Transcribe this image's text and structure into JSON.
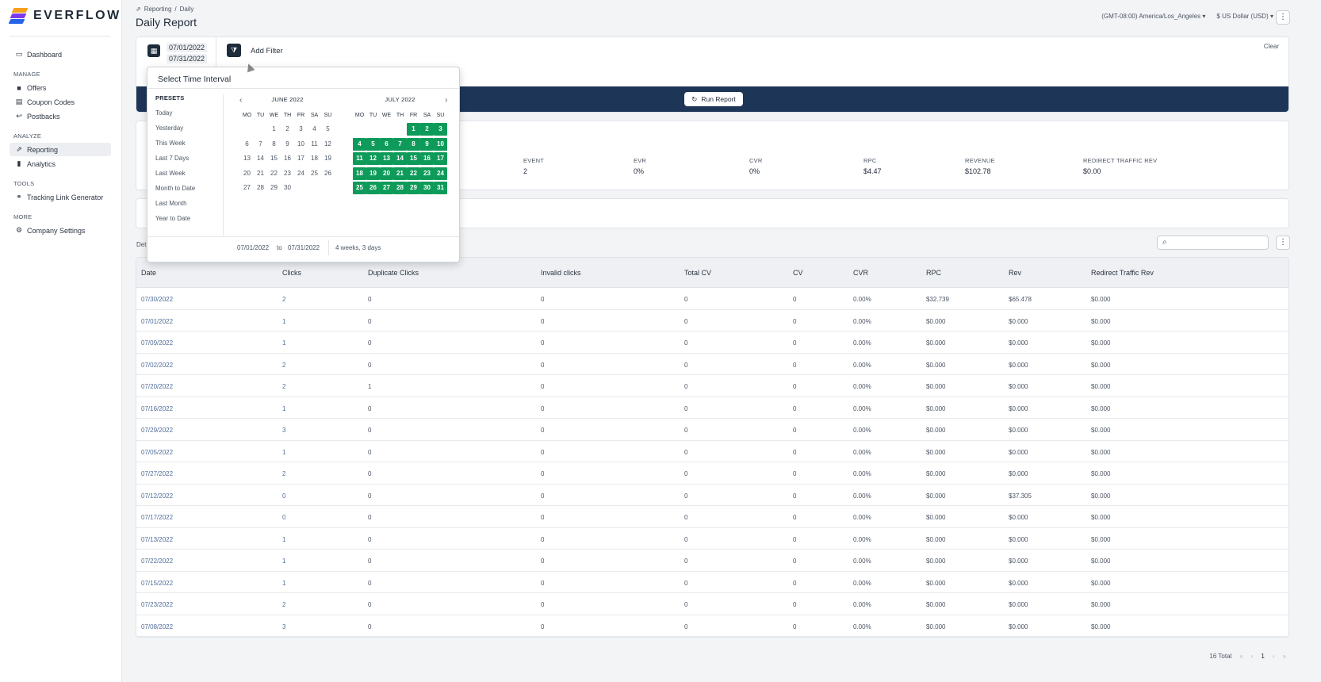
{
  "brand": {
    "name": "EVERFLOW"
  },
  "sidebar": {
    "top_items": [
      {
        "label": "Dashboard",
        "icon": "monitor-icon"
      }
    ],
    "sections": [
      {
        "title": "MANAGE",
        "items": [
          {
            "label": "Offers",
            "icon": "folder-icon"
          },
          {
            "label": "Coupon Codes",
            "icon": "list-icon"
          },
          {
            "label": "Postbacks",
            "icon": "back-arrow-icon"
          }
        ]
      },
      {
        "title": "ANALYZE",
        "items": [
          {
            "label": "Reporting",
            "icon": "chart-line-icon",
            "active": true
          },
          {
            "label": "Analytics",
            "icon": "bar-chart-icon"
          }
        ]
      },
      {
        "title": "TOOLS",
        "items": [
          {
            "label": "Tracking Link Generator",
            "icon": "link-icon"
          }
        ]
      },
      {
        "title": "MORE",
        "items": [
          {
            "label": "Company Settings",
            "icon": "gear-icon"
          }
        ]
      }
    ]
  },
  "header": {
    "breadcrumb": [
      "Reporting",
      "/",
      "Daily"
    ],
    "title": "Daily Report",
    "timezone": "(GMT-08:00) America/Los_Angeles",
    "currency": "$ US Dollar (USD)"
  },
  "filter": {
    "date_from": "07/01/2022",
    "date_to": "07/31/2022",
    "add_filter_label": "Add Filter",
    "clear_label": "Clear",
    "run_label": "Run Report"
  },
  "stats": [
    {
      "label": "EVENT",
      "value": "2"
    },
    {
      "label": "EVR",
      "value": "0%"
    },
    {
      "label": "CVR",
      "value": "0%"
    },
    {
      "label": "RPC",
      "value": "$4.47"
    },
    {
      "label": "REVENUE",
      "value": "$102.78"
    },
    {
      "label": "REDIRECT TRAFFIC REV",
      "value": "$0.00"
    }
  ],
  "details_label": "Det",
  "search": {
    "placeholder": ""
  },
  "table": {
    "columns": [
      "Date",
      "Clicks",
      "Duplicate Clicks",
      "Invalid clicks",
      "Total CV",
      "CV",
      "CVR",
      "RPC",
      "Rev",
      "Redirect Traffic Rev"
    ],
    "rows": [
      [
        "07/30/2022",
        "2",
        "0",
        "0",
        "0",
        "0",
        "0.00%",
        "$32.739",
        "$65.478",
        "$0.000"
      ],
      [
        "07/01/2022",
        "1",
        "0",
        "0",
        "0",
        "0",
        "0.00%",
        "$0.000",
        "$0.000",
        "$0.000"
      ],
      [
        "07/09/2022",
        "1",
        "0",
        "0",
        "0",
        "0",
        "0.00%",
        "$0.000",
        "$0.000",
        "$0.000"
      ],
      [
        "07/02/2022",
        "2",
        "0",
        "0",
        "0",
        "0",
        "0.00%",
        "$0.000",
        "$0.000",
        "$0.000"
      ],
      [
        "07/20/2022",
        "2",
        "1",
        "0",
        "0",
        "0",
        "0.00%",
        "$0.000",
        "$0.000",
        "$0.000"
      ],
      [
        "07/16/2022",
        "1",
        "0",
        "0",
        "0",
        "0",
        "0.00%",
        "$0.000",
        "$0.000",
        "$0.000"
      ],
      [
        "07/29/2022",
        "3",
        "0",
        "0",
        "0",
        "0",
        "0.00%",
        "$0.000",
        "$0.000",
        "$0.000"
      ],
      [
        "07/05/2022",
        "1",
        "0",
        "0",
        "0",
        "0",
        "0.00%",
        "$0.000",
        "$0.000",
        "$0.000"
      ],
      [
        "07/27/2022",
        "2",
        "0",
        "0",
        "0",
        "0",
        "0.00%",
        "$0.000",
        "$0.000",
        "$0.000"
      ],
      [
        "07/12/2022",
        "0",
        "0",
        "0",
        "0",
        "0",
        "0.00%",
        "$0.000",
        "$37.305",
        "$0.000"
      ],
      [
        "07/17/2022",
        "0",
        "0",
        "0",
        "0",
        "0",
        "0.00%",
        "$0.000",
        "$0.000",
        "$0.000"
      ],
      [
        "07/13/2022",
        "1",
        "0",
        "0",
        "0",
        "0",
        "0.00%",
        "$0.000",
        "$0.000",
        "$0.000"
      ],
      [
        "07/22/2022",
        "1",
        "0",
        "0",
        "0",
        "0",
        "0.00%",
        "$0.000",
        "$0.000",
        "$0.000"
      ],
      [
        "07/15/2022",
        "1",
        "0",
        "0",
        "0",
        "0",
        "0.00%",
        "$0.000",
        "$0.000",
        "$0.000"
      ],
      [
        "07/23/2022",
        "2",
        "0",
        "0",
        "0",
        "0",
        "0.00%",
        "$0.000",
        "$0.000",
        "$0.000"
      ],
      [
        "07/08/2022",
        "3",
        "0",
        "0",
        "0",
        "0",
        "0.00%",
        "$0.000",
        "$0.000",
        "$0.000"
      ]
    ]
  },
  "pager": {
    "total": "16 Total",
    "page": "1"
  },
  "picker": {
    "title": "Select Time Interval",
    "presets_title": "PRESETS",
    "presets": [
      "Today",
      "Yesterday",
      "This Week",
      "Last 7 Days",
      "Last Week",
      "Month to Date",
      "Last Month",
      "Year to Date"
    ],
    "dow": [
      "MO",
      "TU",
      "WE",
      "TH",
      "FR",
      "SA",
      "SU"
    ],
    "months": [
      {
        "label": "JUNE  2022",
        "weeks": [
          [
            "",
            "",
            "1",
            "2",
            "3",
            "4",
            "5"
          ],
          [
            "6",
            "7",
            "8",
            "9",
            "10",
            "11",
            "12"
          ],
          [
            "13",
            "14",
            "15",
            "16",
            "17",
            "18",
            "19"
          ],
          [
            "20",
            "21",
            "22",
            "23",
            "24",
            "25",
            "26"
          ],
          [
            "27",
            "28",
            "29",
            "30",
            "",
            "",
            ""
          ]
        ],
        "selected": false
      },
      {
        "label": "JULY  2022",
        "weeks": [
          [
            "",
            "",
            "",
            "",
            "1",
            "2",
            "3"
          ],
          [
            "4",
            "5",
            "6",
            "7",
            "8",
            "9",
            "10"
          ],
          [
            "11",
            "12",
            "13",
            "14",
            "15",
            "16",
            "17"
          ],
          [
            "18",
            "19",
            "20",
            "21",
            "22",
            "23",
            "24"
          ],
          [
            "25",
            "26",
            "27",
            "28",
            "29",
            "30",
            "31"
          ]
        ],
        "selected": true
      }
    ],
    "footer": {
      "from": "07/01/2022",
      "to_word": "to",
      "to": "07/31/2022",
      "duration": "4 weeks, 3 days"
    }
  },
  "colors": {
    "accent": "#1d3557",
    "selected_day": "#0e9b5a",
    "link": "#4f6d9a"
  }
}
